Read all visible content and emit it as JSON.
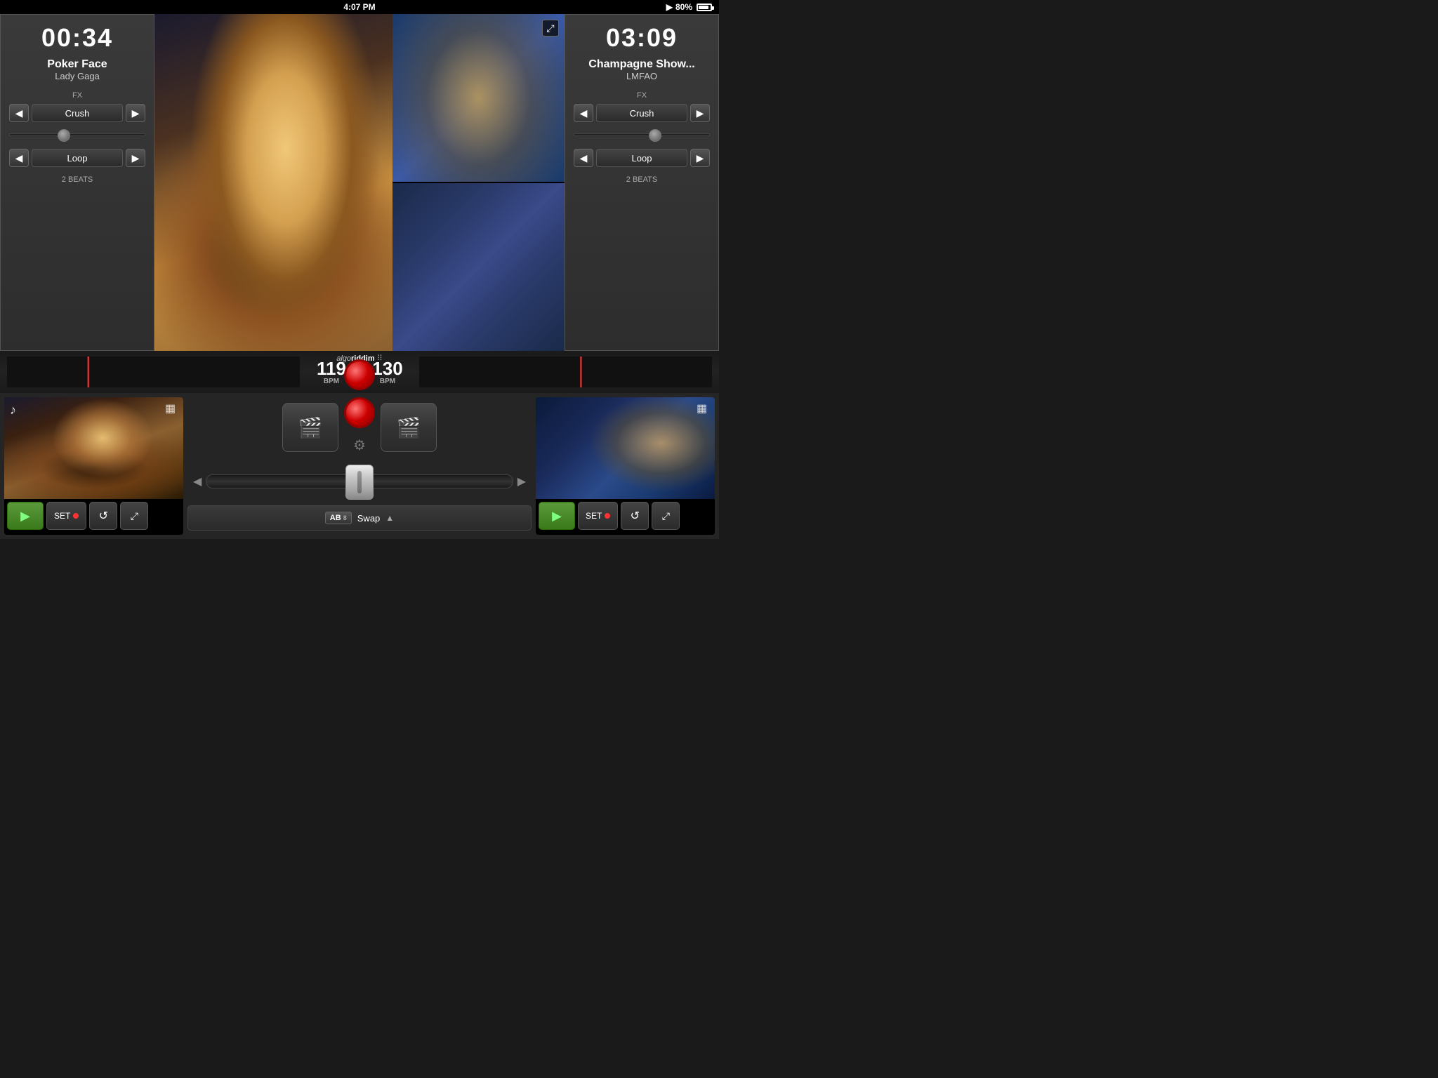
{
  "statusBar": {
    "time": "4:07 PM",
    "battery": "80%",
    "playIcon": "▶"
  },
  "leftDeck": {
    "timer": "00:34",
    "trackName": "Poker Face",
    "artistName": "Lady Gaga",
    "fxLabel": "FX",
    "fxEffect": "Crush",
    "loopLabel": "Loop",
    "loopBeats": "2 BEATS",
    "sliderPosition": "40%",
    "bpm": "119",
    "bpmLabel": "BPM"
  },
  "rightDeck": {
    "timer": "03:09",
    "trackName": "Champagne Show...",
    "artistName": "LMFAO",
    "fxLabel": "FX",
    "fxEffect": "Crush",
    "loopLabel": "Loop",
    "loopBeats": "2 BEATS",
    "sliderPosition": "60%",
    "bpm": "130",
    "bpmLabel": "BPM"
  },
  "logo": {
    "text1": "algo",
    "text2": "riddim",
    "dotsLabel": "⠿"
  },
  "bottomControls": {
    "swapLabel": "Swap",
    "swapAB": "AB",
    "setLabel": "SET",
    "leftPlayIcon": "▶",
    "rightPlayIcon": "▶",
    "loopIcon": "↺",
    "scratchIcon": "⤢",
    "mediaIcon1": "🎬",
    "mediaIcon2": "🎬",
    "gearIcon": "⚙",
    "arrowLeft": "◀",
    "arrowRight": "▶"
  },
  "icons": {
    "expand": "⤢",
    "musicNote": "♪",
    "filmStrip": "▦",
    "chevronUp": "▲",
    "chevronLeft": "◀",
    "chevronRight": "▶",
    "setDot": "●",
    "loopArrow": "↺",
    "scratchArrow": "⤢"
  }
}
